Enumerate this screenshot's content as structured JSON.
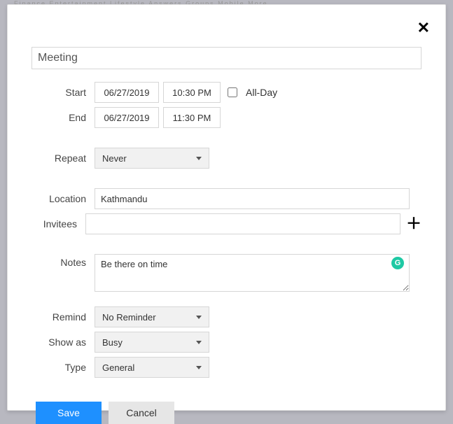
{
  "bg_nav": "Finance    Entertainment    Lifestyle    Answers    Groups    Mobile    More",
  "title": "Meeting",
  "labels": {
    "start": "Start",
    "end": "End",
    "repeat": "Repeat",
    "location": "Location",
    "invitees": "Invitees",
    "notes": "Notes",
    "remind": "Remind",
    "show_as": "Show as",
    "type": "Type"
  },
  "start": {
    "date": "06/27/2019",
    "time": "10:30 PM"
  },
  "end": {
    "date": "06/27/2019",
    "time": "11:30 PM"
  },
  "all_day": {
    "label": "All-Day",
    "checked": false
  },
  "repeat": "Never",
  "location": "Kathmandu",
  "invitees": "",
  "notes": "Be there on time",
  "remind": "No Reminder",
  "show_as": "Busy",
  "type": "General",
  "buttons": {
    "save": "Save",
    "cancel": "Cancel"
  },
  "grammar_badge": "G"
}
